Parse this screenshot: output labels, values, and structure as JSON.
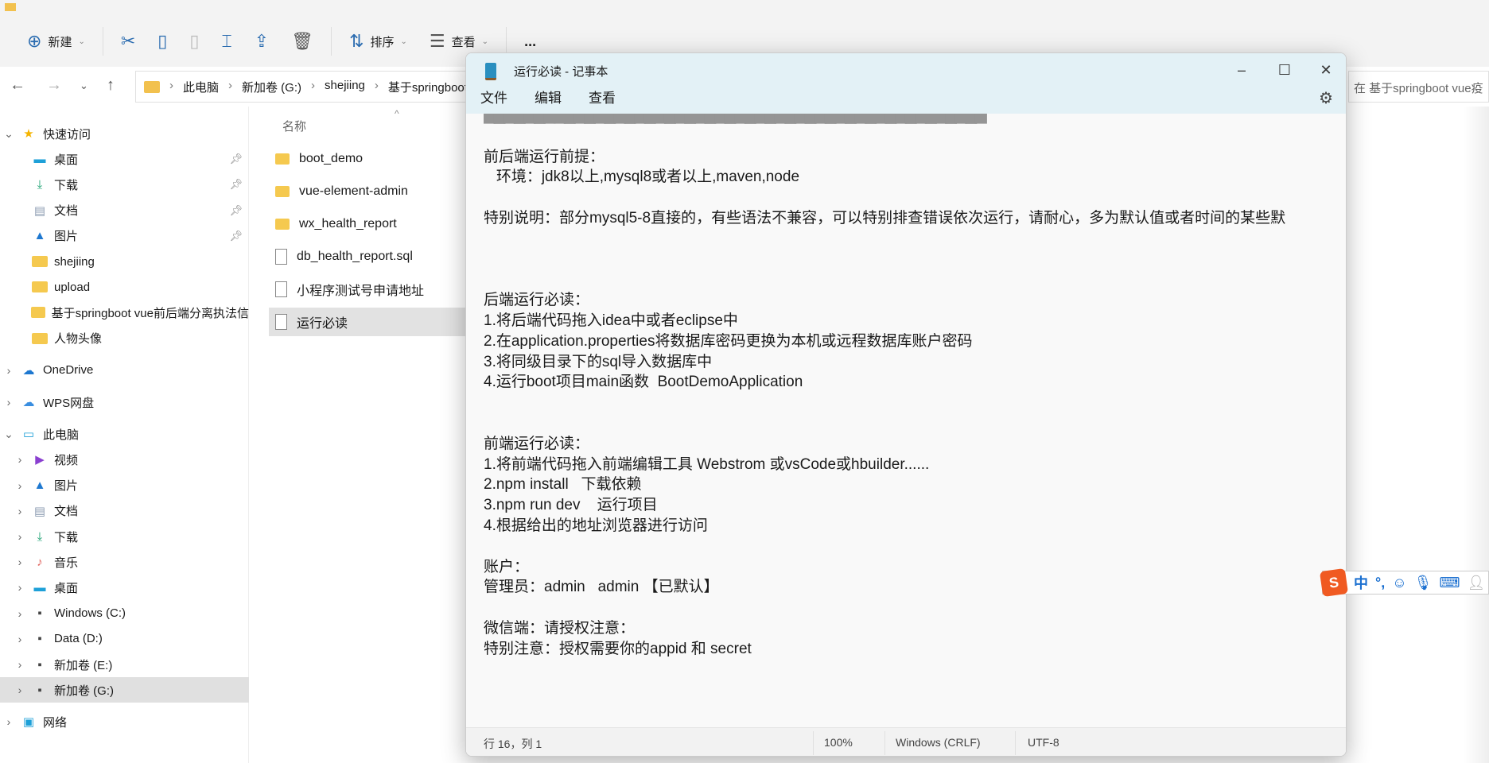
{
  "explorer": {
    "toolbar": {
      "new": "新建",
      "sort": "排序",
      "view": "查看",
      "more": "..."
    },
    "breadcrumb": [
      "此电脑",
      "新加卷 (G:)",
      "shejiing",
      "基于springboot"
    ],
    "search_placeholder": "在 基于springboot vue疫",
    "column_name": "名称",
    "sidebar": [
      {
        "label": "快速访问",
        "level": 0,
        "chev": "⌄",
        "icon": "★",
        "color": "#f5b400",
        "pin": false
      },
      {
        "label": "桌面",
        "level": 1,
        "icon": "▬",
        "color": "#1ea0d8",
        "pin": true
      },
      {
        "label": "下载",
        "level": 1,
        "icon": "⤓",
        "color": "#1aa070",
        "pin": true
      },
      {
        "label": "文档",
        "level": 1,
        "icon": "▤",
        "color": "#8a9ab0",
        "pin": true
      },
      {
        "label": "图片",
        "level": 1,
        "icon": "▲",
        "color": "#1e78d0",
        "pin": true
      },
      {
        "label": "shejiing",
        "level": 1,
        "icon": "folder",
        "pin": false
      },
      {
        "label": "upload",
        "level": 1,
        "icon": "folder",
        "pin": false
      },
      {
        "label": "基于springboot vue前后端分离执法信",
        "level": 1,
        "icon": "folder",
        "pin": false
      },
      {
        "label": "人物头像",
        "level": 1,
        "icon": "folder",
        "pin": false
      },
      {
        "label": "OneDrive",
        "level": 0,
        "chev": "›",
        "icon": "☁",
        "color": "#1e78d0",
        "gap": true
      },
      {
        "label": "WPS网盘",
        "level": 0,
        "chev": "›",
        "icon": "☁",
        "color": "#3a8ee0",
        "gap": true
      },
      {
        "label": "此电脑",
        "level": 0,
        "chev": "⌄",
        "icon": "▭",
        "color": "#1ea0d8",
        "gap": true
      },
      {
        "label": "视频",
        "level": 1,
        "chev": "›",
        "icon": "▶",
        "color": "#8a3fd0"
      },
      {
        "label": "图片",
        "level": 1,
        "chev": "›",
        "icon": "▲",
        "color": "#1e78d0"
      },
      {
        "label": "文档",
        "level": 1,
        "chev": "›",
        "icon": "▤",
        "color": "#8a9ab0"
      },
      {
        "label": "下载",
        "level": 1,
        "chev": "›",
        "icon": "⤓",
        "color": "#1aa070"
      },
      {
        "label": "音乐",
        "level": 1,
        "chev": "›",
        "icon": "♪",
        "color": "#e0605a"
      },
      {
        "label": "桌面",
        "level": 1,
        "chev": "›",
        "icon": "▬",
        "color": "#1ea0d8"
      },
      {
        "label": "Windows (C:)",
        "level": 1,
        "chev": "›",
        "icon": "▪",
        "color": "#444"
      },
      {
        "label": "Data (D:)",
        "level": 1,
        "chev": "›",
        "icon": "▪",
        "color": "#444"
      },
      {
        "label": "新加卷 (E:)",
        "level": 1,
        "chev": "›",
        "icon": "▪",
        "color": "#444"
      },
      {
        "label": "新加卷 (G:)",
        "level": 1,
        "chev": "›",
        "icon": "▪",
        "color": "#444",
        "selected": true
      },
      {
        "label": "网络",
        "level": 0,
        "chev": "›",
        "icon": "▣",
        "color": "#1ea0d8",
        "gap": true
      }
    ],
    "files": [
      {
        "name": "boot_demo",
        "type": "folder"
      },
      {
        "name": "vue-element-admin",
        "type": "folder"
      },
      {
        "name": "wx_health_report",
        "type": "folder"
      },
      {
        "name": "db_health_report.sql",
        "type": "file"
      },
      {
        "name": "小程序测试号申请地址",
        "type": "file"
      },
      {
        "name": "运行必读",
        "type": "file",
        "selected": true
      }
    ]
  },
  "notepad": {
    "title": "运行必读 - 记事本",
    "menu": [
      "文件",
      "编辑",
      "查看"
    ],
    "lines": [
      "",
      "",
      "前后端运行前提：",
      "   环境：jdk8以上,mysql8或者以上,maven,node",
      "",
      "特别说明：部分mysql5-8直接的，有些语法不兼容，可以特别排查错误依次运行，请耐心，多为默认值或者时间的某些默",
      "",
      "",
      "",
      "后端运行必读：",
      "1.将后端代码拖入idea中或者eclipse中",
      "2.在application.properties将数据库密码更换为本机或远程数据库账户密码",
      "3.将同级目录下的sql导入数据库中",
      "4.运行boot项目main函数  BootDemoApplication",
      "",
      "",
      "前端运行必读：",
      "1.将前端代码拖入前端编辑工具 Webstrom 或vsCode或hbuilder......",
      "2.npm install   下载依赖",
      "3.npm run dev    运行项目",
      "4.根据给出的地址浏览器进行访问",
      "",
      "账户：",
      "管理员：admin   admin 【已默认】",
      "",
      "微信端：请授权注意：",
      "特别注意：授权需要你的appid 和 secret"
    ],
    "status": {
      "position": "行 16，列 1",
      "zoom": "100%",
      "line_ending": "Windows (CRLF)",
      "encoding": "UTF-8"
    }
  },
  "ime": {
    "logo": "S",
    "mode": "中",
    "punct": "°,"
  }
}
